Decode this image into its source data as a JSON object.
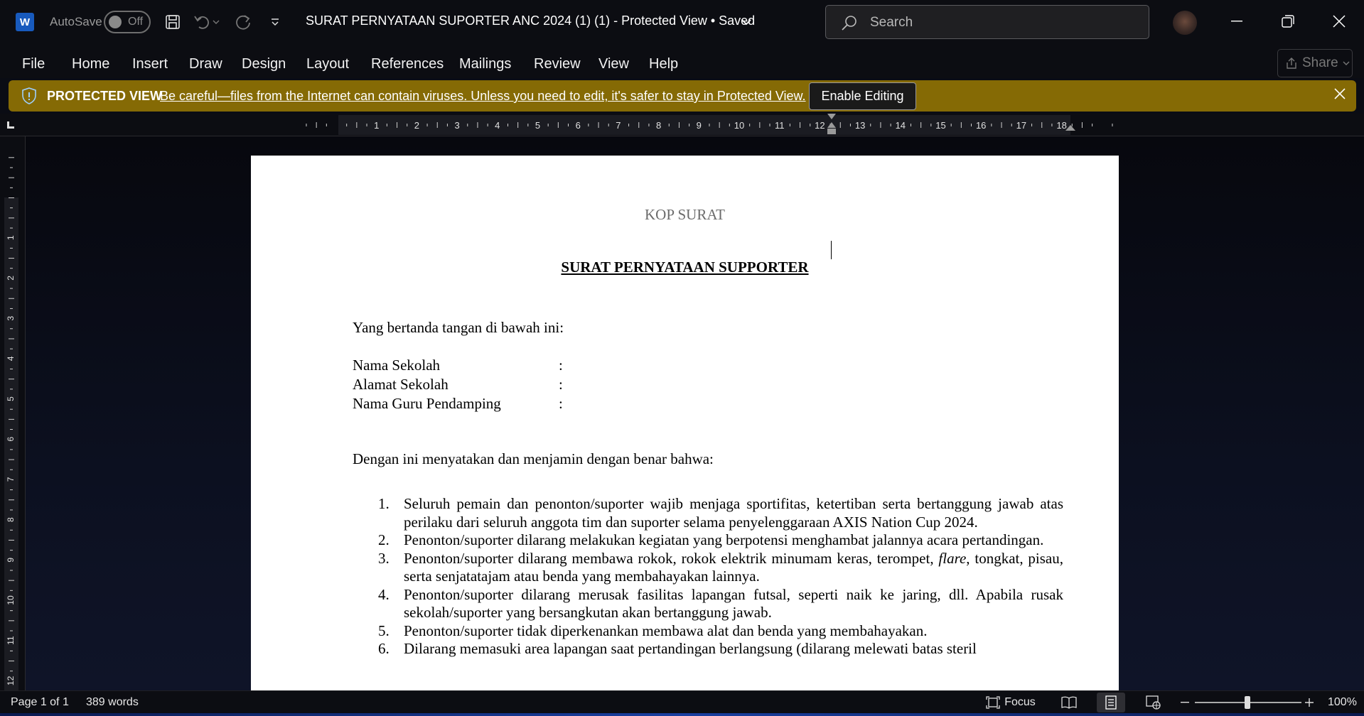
{
  "app": {
    "logo_letter": "W",
    "autosave_label": "AutoSave",
    "autosave_state": "Off",
    "title": "SURAT PERNYATAAN SUPORTER ANC 2024 (1) (1)  -  Protected View • Saved"
  },
  "search": {
    "placeholder": "Search"
  },
  "menu": [
    "File",
    "Home",
    "Insert",
    "Draw",
    "Design",
    "Layout",
    "References",
    "Mailings",
    "Review",
    "View",
    "Help"
  ],
  "share_label": "Share",
  "protected_view": {
    "label": "PROTECTED VIEW",
    "message": "Be careful—files from the Internet can contain viruses. Unless you need to edit, it's safer to stay in Protected View.",
    "button": "Enable Editing",
    "color": "#856a05"
  },
  "ruler": {
    "h_numbers": [
      "1",
      "2",
      "3",
      "4",
      "5",
      "6",
      "7",
      "8",
      "9",
      "10",
      "11",
      "12",
      "13",
      "14",
      "15",
      "16",
      "17",
      "18"
    ],
    "v_numbers": [
      "1",
      "2",
      "3",
      "4",
      "5",
      "6",
      "7",
      "8",
      "9",
      "10",
      "11",
      "12"
    ]
  },
  "document": {
    "kop": "KOP SURAT",
    "heading": "SURAT PERNYATAAN SUPPORTER",
    "intro": "Yang bertanda tangan di bawah ini:",
    "fields": [
      {
        "label": "Nama Sekolah",
        "sep": ":"
      },
      {
        "label": "Alamat Sekolah",
        "sep": ":"
      },
      {
        "label": "Nama Guru Pendamping",
        "sep": ":"
      }
    ],
    "statement": "Dengan ini menyatakan dan menjamin dengan benar bahwa:",
    "clauses": [
      {
        "num": "1.",
        "text": "Seluruh pemain dan penonton/suporter wajib menjaga sportifitas, ketertiban serta bertanggung jawab atas perilaku dari seluruh anggota tim dan suporter selama penyelenggaraan AXIS Nation Cup 2024."
      },
      {
        "num": "2.",
        "text": "Penonton/suporter dilarang melakukan kegiatan yang berpotensi menghambat jalannya acara pertandingan."
      },
      {
        "num": "3.",
        "text_before": "Penonton/suporter dilarang membawa rokok, rokok elektrik minumam keras, terompet, ",
        "text_italic": "flare",
        "text_after": ", tongkat, pisau, serta senjatatajam atau benda yang membahayakan lainnya."
      },
      {
        "num": "4.",
        "text": "Penonton/suporter dilarang merusak fasilitas lapangan futsal, seperti naik ke jaring, dll. Apabila rusak sekolah/suporter yang bersangkutan akan bertanggung jawab."
      },
      {
        "num": "5.",
        "text": "Penonton/suporter tidak diperkenankan membawa alat dan benda yang membahayakan."
      },
      {
        "num": "6.",
        "text": "Dilarang memasuki area lapangan saat pertandingan berlangsung (dilarang melewati batas steril"
      }
    ]
  },
  "status": {
    "page": "Page 1 of 1",
    "words": "389 words",
    "focus": "Focus",
    "zoom": "100%",
    "zoom_level": 1.0
  }
}
